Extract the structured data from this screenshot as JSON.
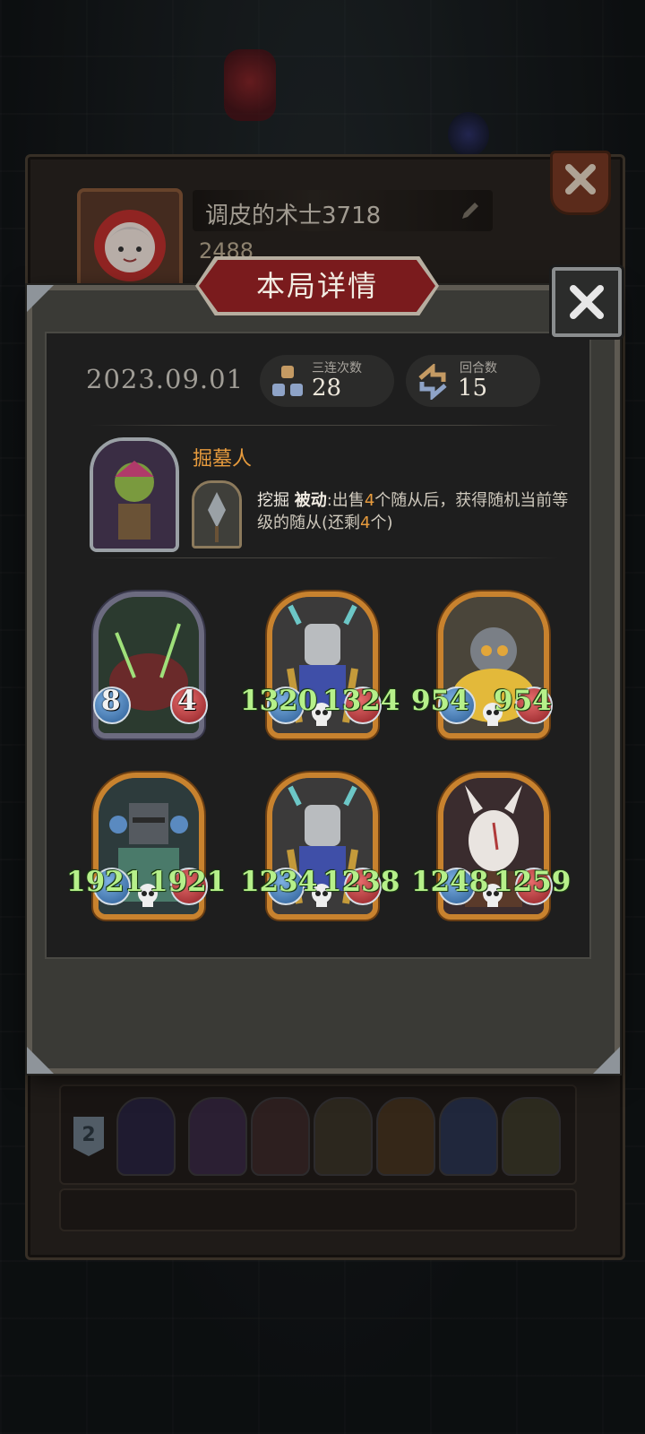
{
  "background_profile": {
    "player_name": "调皮的术士3718",
    "coins": "2488",
    "rank_row_2": "2"
  },
  "dialog": {
    "title": "本局详情",
    "date": "2023.09.01",
    "stats": {
      "triples_label": "三连次数",
      "triples_value": "28",
      "rounds_label": "回合数",
      "rounds_value": "15"
    },
    "hero": {
      "name": "掘墓人",
      "skill_name": "挖掘",
      "skill_type": "被动",
      "skill_text_1": ":出售",
      "skill_count": "4",
      "skill_text_2": "个随从后，获得随机当前等级的随从(还剩",
      "skill_remaining": "4",
      "skill_text_3": "个)"
    },
    "minions": [
      {
        "attack": "8",
        "health": "4",
        "frame": "silver"
      },
      {
        "attack": "1320",
        "health": "1324",
        "frame": "gold"
      },
      {
        "attack": "954",
        "health": "954",
        "frame": "gold"
      },
      {
        "attack": "1921",
        "health": "1921",
        "frame": "gold"
      },
      {
        "attack": "1234",
        "health": "1238",
        "frame": "gold"
      },
      {
        "attack": "1248",
        "health": "1259",
        "frame": "gold"
      }
    ]
  },
  "icons": {
    "close": "close-icon",
    "triples": "triple-merge-icon",
    "rounds": "rounds-cycle-icon",
    "skull": "skull-icon",
    "edit": "pencil-icon"
  },
  "colors": {
    "hero_name": "#e79b3d",
    "stat_number": "#b6f08a",
    "title_banner": "#7a1b1d",
    "gold_frame": "#c8822e"
  }
}
